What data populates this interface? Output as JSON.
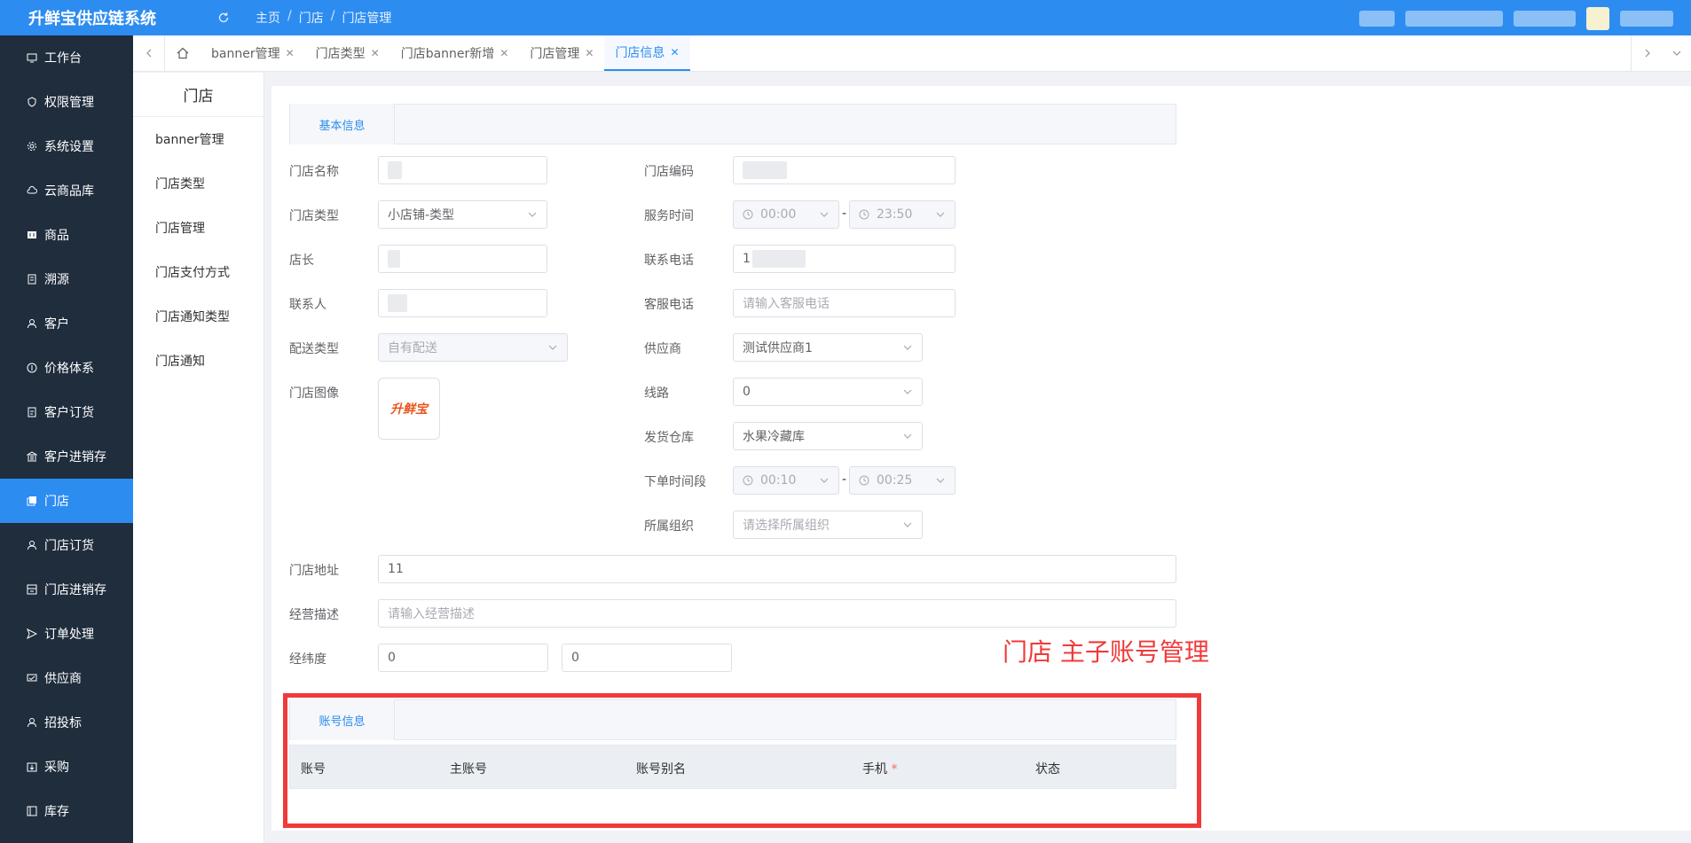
{
  "header": {
    "app_title": "升鲜宝供应链系统",
    "breadcrumb": [
      "主页",
      "门店",
      "门店管理"
    ]
  },
  "sidebar": {
    "items": [
      {
        "label": "工作台",
        "icon": "monitor-icon"
      },
      {
        "label": "权限管理",
        "icon": "shield-icon"
      },
      {
        "label": "系统设置",
        "icon": "gear-icon"
      },
      {
        "label": "云商品库",
        "icon": "cloud-icon"
      },
      {
        "label": "商品",
        "icon": "goods-icon"
      },
      {
        "label": "溯源",
        "icon": "trace-icon"
      },
      {
        "label": "客户",
        "icon": "user-icon"
      },
      {
        "label": "价格体系",
        "icon": "price-icon"
      },
      {
        "label": "客户订货",
        "icon": "order-icon"
      },
      {
        "label": "客户进销存",
        "icon": "bank-icon"
      },
      {
        "label": "门店",
        "icon": "store-icon",
        "active": true
      },
      {
        "label": "门店订货",
        "icon": "user-icon"
      },
      {
        "label": "门店进销存",
        "icon": "inventory-icon"
      },
      {
        "label": "订单处理",
        "icon": "send-icon"
      },
      {
        "label": "供应商",
        "icon": "supplier-icon"
      },
      {
        "label": "招投标",
        "icon": "user-icon"
      },
      {
        "label": "采购",
        "icon": "purchase-icon"
      },
      {
        "label": "库存",
        "icon": "stock-icon"
      }
    ]
  },
  "tabs": [
    {
      "label": "banner管理"
    },
    {
      "label": "门店类型"
    },
    {
      "label": "门店banner新增"
    },
    {
      "label": "门店管理"
    },
    {
      "label": "门店信息",
      "active": true
    }
  ],
  "submenu": {
    "title": "门店",
    "items": [
      "banner管理",
      "门店类型",
      "门店管理",
      "门店支付方式",
      "门店通知类型",
      "门店通知"
    ]
  },
  "form": {
    "section_basic": "基本信息",
    "store_name_label": "门店名称",
    "store_code_label": "门店编码",
    "store_type_label": "门店类型",
    "store_type_value": "小店铺-类型",
    "service_time_label": "服务时间",
    "service_start": "00:00",
    "service_end": "23:50",
    "time_sep": "-",
    "manager_label": "店长",
    "phone_label": "联系电话",
    "phone_value": "1",
    "contact_label": "联系人",
    "cs_phone_label": "客服电话",
    "cs_phone_placeholder": "请输入客服电话",
    "delivery_type_label": "配送类型",
    "delivery_type_value": "自有配送",
    "supplier_label": "供应商",
    "supplier_value": "测试供应商1",
    "store_image_label": "门店图像",
    "store_image_logo": "升鲜宝",
    "route_label": "线路",
    "route_value": "0",
    "warehouse_label": "发货仓库",
    "warehouse_value": "水果冷藏库",
    "order_time_label": "下单时间段",
    "order_start": "00:10",
    "order_end": "00:25",
    "org_label": "所属组织",
    "org_placeholder": "请选择所属组织",
    "address_label": "门店地址",
    "address_value": "11",
    "desc_label": "经营描述",
    "desc_placeholder": "请输入经营描述",
    "latlng_label": "经纬度",
    "lng_value": "0",
    "lat_value": "0"
  },
  "annotation": "门店 主子账号管理",
  "account": {
    "section_title": "账号信息",
    "columns": [
      "账号",
      "主账号",
      "账号别名",
      "手机",
      "状态"
    ],
    "required_mark": "*"
  }
}
